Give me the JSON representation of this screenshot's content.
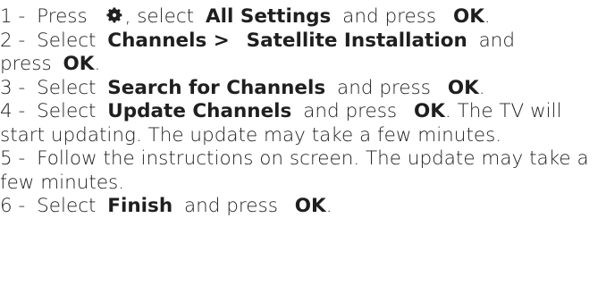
{
  "steps": [
    {
      "num": "1 -",
      "t1": "Press",
      "icon": "gear-icon",
      "t2": ", select",
      "b1": "All Settings",
      "t3": "and press",
      "b2": "OK",
      "t4": "."
    },
    {
      "num": "2 -",
      "t1": "Select",
      "b1": "Channels >",
      "b2": "Satellite Installation",
      "t2": "and",
      "t3": "press",
      "b3": "OK",
      "t4": "."
    },
    {
      "num": "3 -",
      "t1": "Select",
      "b1": "Search for Channels",
      "t2": "and press",
      "b2": "OK",
      "t3": "."
    },
    {
      "num": "4 -",
      "t1": "Select",
      "b1": "Update Channels",
      "t2": "and press",
      "b2": "OK",
      "t3": ". The TV will start updating. The update may take a few minutes."
    },
    {
      "num": "5 -",
      "t1": "Follow the instructions on screen. The update may take a few minutes."
    },
    {
      "num": "6 -",
      "t1": "Select",
      "b1": "Finish",
      "t2": "and press",
      "b2": "OK",
      "t3": "."
    }
  ]
}
